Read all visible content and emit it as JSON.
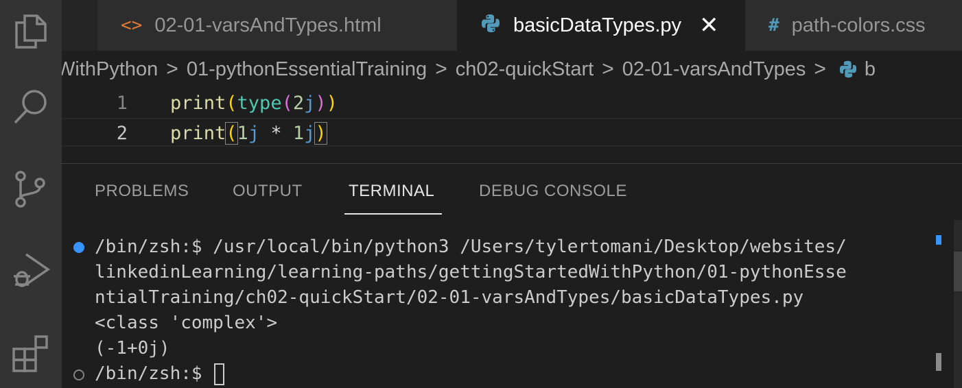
{
  "activity_bar": {
    "icons": [
      "files-icon",
      "search-icon",
      "source-control-icon",
      "run-debug-icon",
      "extensions-icon"
    ]
  },
  "tabs": [
    {
      "icon": "<>",
      "label": "02-01-varsAndTypes.html",
      "active": false
    },
    {
      "icon": "python-icon",
      "label": "basicDataTypes.py",
      "active": true,
      "close": "✕"
    },
    {
      "icon": "#",
      "label": "path-colors.css",
      "active": false
    }
  ],
  "breadcrumbs": [
    "WithPython",
    "01-pythonEssentialTraining",
    "ch02-quickStart",
    "02-01-varsAndTypes",
    "b"
  ],
  "breadcrumb_separator": ">",
  "editor": {
    "lines": [
      {
        "number": "1",
        "text": "print(type(2j))"
      },
      {
        "number": "2",
        "text": "print(1j * 1j)"
      }
    ]
  },
  "panel": {
    "tabs": [
      "PROBLEMS",
      "OUTPUT",
      "TERMINAL",
      "DEBUG CONSOLE"
    ],
    "active_tab": "TERMINAL"
  },
  "terminal": {
    "lines": [
      "/bin/zsh:$ /usr/local/bin/python3 /Users/tylertomani/Desktop/websites/",
      "linkedinLearning/learning-paths/gettingStartedWithPython/01-pythonEsse",
      "ntialTraining/ch02-quickStart/02-01-varsAndTypes/basicDataTypes.py",
      "<class 'complex'>",
      "(-1+0j)",
      "/bin/zsh:$ "
    ]
  },
  "colors": {
    "activity_bar": "#333333",
    "editor_bg": "#1e1e1e",
    "accent_blue": "#3794ff",
    "function_yellow": "#dcdcaa",
    "builtin_teal": "#4ec9b0"
  }
}
